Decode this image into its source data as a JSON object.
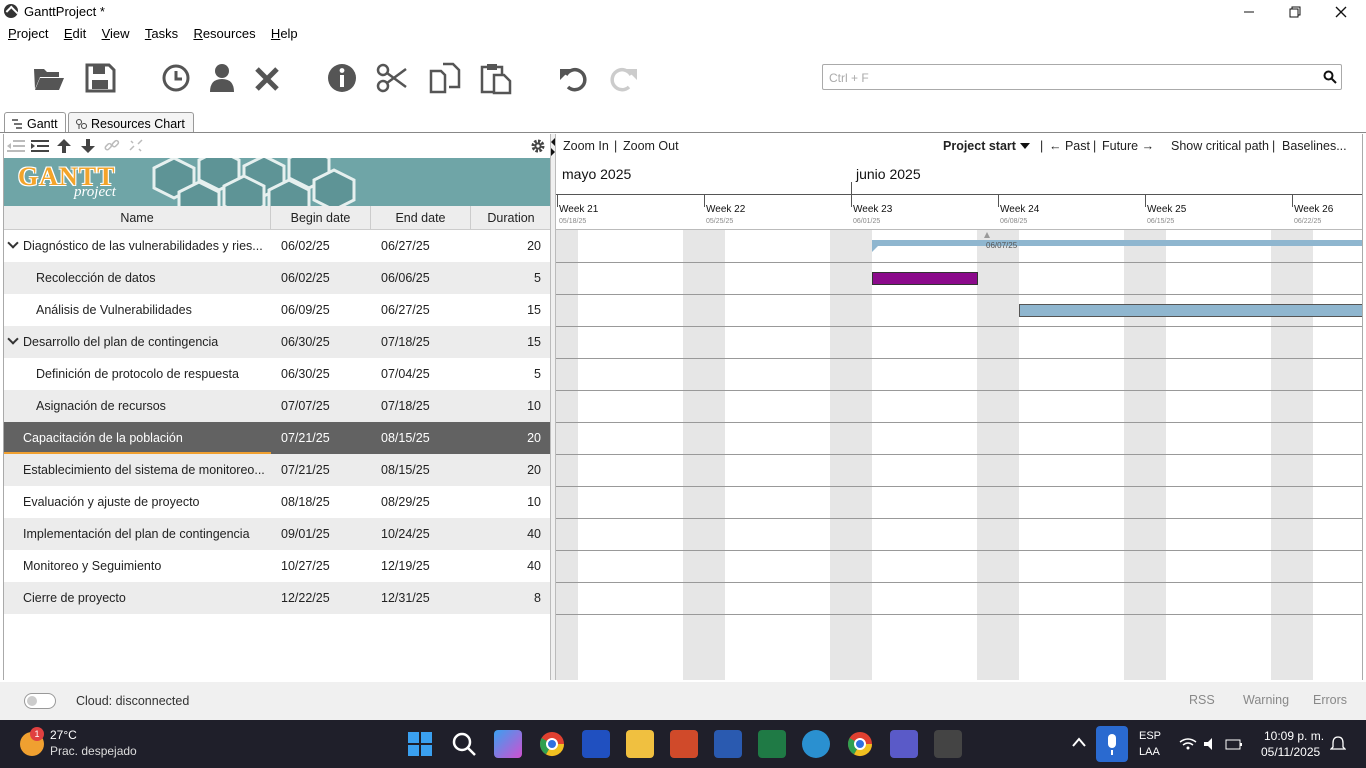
{
  "window": {
    "title": "GanttProject *"
  },
  "menu": [
    "Project",
    "Edit",
    "View",
    "Tasks",
    "Resources",
    "Help"
  ],
  "search": {
    "placeholder": "Ctrl + F"
  },
  "tabs": [
    {
      "label": "Gantt"
    },
    {
      "label": "Resources Chart"
    }
  ],
  "banner": {
    "logo": "GANTT",
    "logo_sub": "project"
  },
  "columns": {
    "name": "Name",
    "begin": "Begin date",
    "end": "End date",
    "duration": "Duration"
  },
  "tasks": [
    {
      "name": "Diagnóstico de las vulnerabilidades y ries...",
      "begin": "06/02/25",
      "end": "06/27/25",
      "duration": "20"
    },
    {
      "name": "Recolección de datos",
      "begin": "06/02/25",
      "end": "06/06/25",
      "duration": "5"
    },
    {
      "name": "Análisis de Vulnerabilidades",
      "begin": "06/09/25",
      "end": "06/27/25",
      "duration": "15"
    },
    {
      "name": "Desarrollo del plan de contingencia",
      "begin": "06/30/25",
      "end": "07/18/25",
      "duration": "15"
    },
    {
      "name": "Definición de protocolo de respuesta",
      "begin": "06/30/25",
      "end": "07/04/25",
      "duration": "5"
    },
    {
      "name": "Asignación de recursos",
      "begin": "07/07/25",
      "end": "07/18/25",
      "duration": "10"
    },
    {
      "name": "Capacitación de la población",
      "begin": "07/21/25",
      "end": "08/15/25",
      "duration": "20"
    },
    {
      "name": "Establecimiento del sistema de monitoreo...",
      "begin": "07/21/25",
      "end": "08/15/25",
      "duration": "20"
    },
    {
      "name": "Evaluación y ajuste de proyecto",
      "begin": "08/18/25",
      "end": "08/29/25",
      "duration": "10"
    },
    {
      "name": "Implementación del plan de contingencia",
      "begin": "09/01/25",
      "end": "10/24/25",
      "duration": "40"
    },
    {
      "name": "Monitoreo y Seguimiento",
      "begin": "10/27/25",
      "end": "12/19/25",
      "duration": "40"
    },
    {
      "name": "Cierre de proyecto",
      "begin": "12/22/25",
      "end": "12/31/25",
      "duration": "8"
    }
  ],
  "chart_toolbar": {
    "zoom_in": "Zoom In",
    "sep1": "|",
    "zoom_out": "Zoom Out",
    "project_start": "Project start",
    "sep2": "|",
    "past": "← Past",
    "sep3": "|",
    "future": "Future →",
    "critical_path": "Show critical path",
    "sep4": "|",
    "baselines": "Baselines..."
  },
  "timeline": {
    "months": [
      "mayo 2025",
      "junio 2025"
    ],
    "weeks": [
      {
        "label": "Week 21",
        "date": "05/18/25"
      },
      {
        "label": "Week 22",
        "date": "05/25/25"
      },
      {
        "label": "Week 23",
        "date": "06/01/25"
      },
      {
        "label": "Week 24",
        "date": "06/08/25"
      },
      {
        "label": "Week 25",
        "date": "06/15/25"
      },
      {
        "label": "Week 26",
        "date": "06/22/25"
      }
    ],
    "marker_date": "06/07/25"
  },
  "colors": {
    "subtask_bar": "#8b0a8b",
    "task_bar": "#8fb6cf",
    "summary_bar": "#8fb6cf",
    "selected_row": "#626262",
    "accent": "#f0a030"
  },
  "status": {
    "cloud": "Cloud: disconnected",
    "rss": "RSS",
    "warning": "Warning",
    "errors": "Errors"
  },
  "taskbar": {
    "temp": "27°C",
    "weather": "Prac. despejado",
    "badge": "1",
    "lang": "ESP",
    "lang2": "LAA",
    "time": "10:09 p. m.",
    "date": "05/11/2025"
  }
}
